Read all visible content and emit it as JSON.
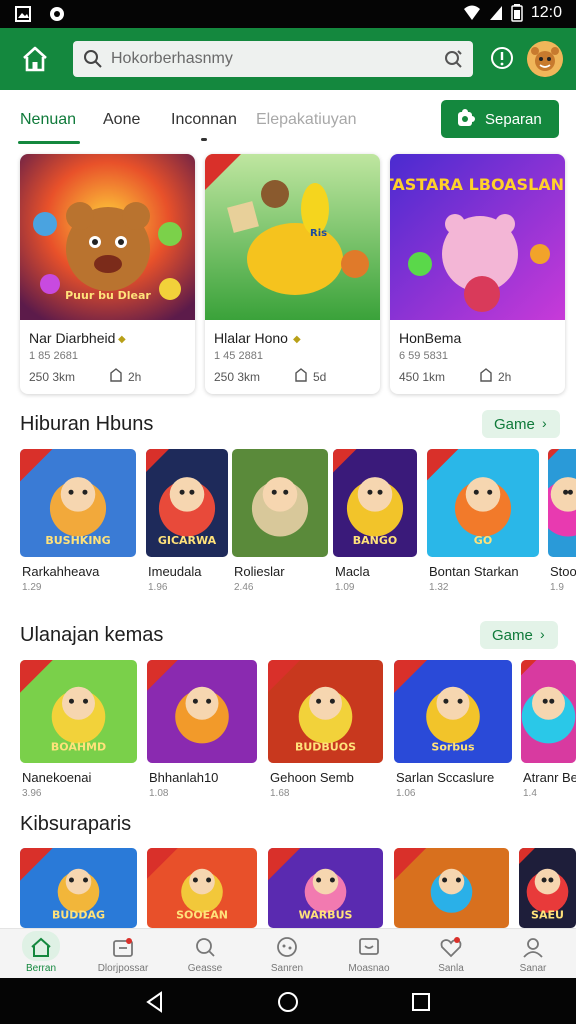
{
  "status_bar": {
    "time": "12:0"
  },
  "header": {
    "search_placeholder": "Hokorberhasnmy"
  },
  "tabs": [
    {
      "label": "Nenuan"
    },
    {
      "label": "Aone"
    },
    {
      "label": "Inconnan"
    },
    {
      "label": "Elepakatiuyan"
    }
  ],
  "action_button": {
    "label": "Separan"
  },
  "featured": [
    {
      "art_text": "Puur bu Dlear",
      "title": "Nar Diarbheid",
      "sub": "1 85 2681",
      "meta": "250 3km",
      "count": "2h"
    },
    {
      "art_text": "Ris",
      "title": "Hlalar Hono",
      "sub": "1 45 2881",
      "meta": "250 3km",
      "count": "5d"
    },
    {
      "art_text": "TASTARA LBOASLAN!",
      "title": "HonBema",
      "sub": "6 59 5831",
      "meta": "450 1km",
      "count": "2h"
    }
  ],
  "sections": [
    {
      "title": "Hiburan Hbuns",
      "button": "Game",
      "tiles": [
        {
          "title": "Rarkahheava",
          "sub": "1.29",
          "art_text": "BUSHKING"
        },
        {
          "title": "Imeudala",
          "sub": "1.96",
          "art_text": "GICARWA"
        },
        {
          "title": "Rolieslar",
          "sub": "2.46",
          "art_text": ""
        },
        {
          "title": "Macla",
          "sub": "1.09",
          "art_text": "BANGO"
        },
        {
          "title": "Bontan Starkan",
          "sub": "1.32",
          "art_text": "GO"
        },
        {
          "title": "Stoo",
          "sub": "1.9",
          "art_text": ""
        }
      ]
    },
    {
      "title": "Ulanajan kemas",
      "button": "Game",
      "tiles": [
        {
          "title": "Nanekoenai",
          "sub": "3.96",
          "art_text": "BOAHMD"
        },
        {
          "title": "Bhhanlah10",
          "sub": "1.08",
          "art_text": ""
        },
        {
          "title": "Gehoon Semb",
          "sub": "1.68",
          "art_text": "BUDBUOS"
        },
        {
          "title": "Sarlan Sccaslure",
          "sub": "1.06",
          "art_text": "Sorbus"
        },
        {
          "title": "Atranr Be",
          "sub": "1.4",
          "art_text": ""
        }
      ]
    },
    {
      "title": "Kibsuraparis",
      "tiles": [
        {
          "art_text": "BUDDAG"
        },
        {
          "art_text": "SOOEAN"
        },
        {
          "art_text": "WARBUS"
        },
        {
          "art_text": ""
        },
        {
          "art_text": "SAEU"
        }
      ]
    }
  ],
  "bottom_nav": [
    {
      "label": "Berran",
      "icon": "home-icon"
    },
    {
      "label": "Dlorjpossar",
      "icon": "gift-icon"
    },
    {
      "label": "Geasse",
      "icon": "search-icon"
    },
    {
      "label": "Sanren",
      "icon": "controller-icon"
    },
    {
      "label": "Moasnao",
      "icon": "chat-icon"
    },
    {
      "label": "Sanla",
      "icon": "heart-icon"
    },
    {
      "label": "Sanar",
      "icon": "user-icon"
    }
  ],
  "colors": {
    "brand": "#14883e",
    "accent_light": "#e3f3e8",
    "ribbon": "#d9302a"
  }
}
